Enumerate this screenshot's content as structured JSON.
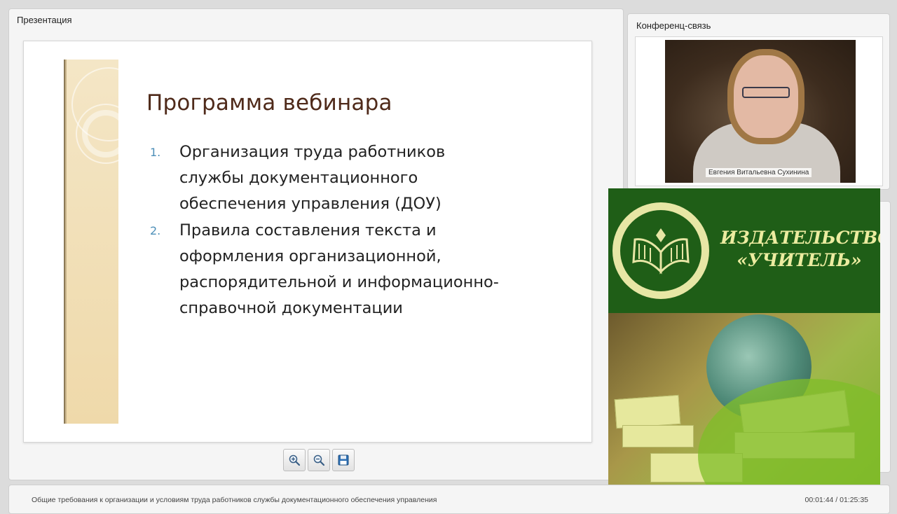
{
  "presentation": {
    "title": "Презентация",
    "slide": {
      "heading": "Программа вебинара",
      "items": [
        {
          "num": "1.",
          "text": "Организация труда работников службы документационного обеспечения управления (ДОУ)"
        },
        {
          "num": "2.",
          "text": "Правила составления текста и оформления организационной, распорядительной и информационно-справочной документации"
        }
      ]
    },
    "toolbar": {
      "zoom_in_icon": "zoom-in-icon",
      "zoom_out_icon": "zoom-out-icon",
      "save_icon": "floppy-disk-icon"
    }
  },
  "conference": {
    "title": "Конференц-связь",
    "speaker_name": "Евгения Витальевна Сухинина"
  },
  "ad": {
    "publisher_line1": "ИЗДАТЕЛЬСТВО",
    "publisher_line2": "«УЧИТЕЛЬ»"
  },
  "footer": {
    "webinar_title": "Общие требования к организации и условиям труда работников службы документационного обеспечения управления",
    "timecode": "00:01:44 / 01:25:35"
  },
  "colors": {
    "slide_heading": "#4f2a1a",
    "list_number": "#4d8fb8",
    "ad_green": "#1f5e17",
    "ad_text": "#ececa0"
  }
}
